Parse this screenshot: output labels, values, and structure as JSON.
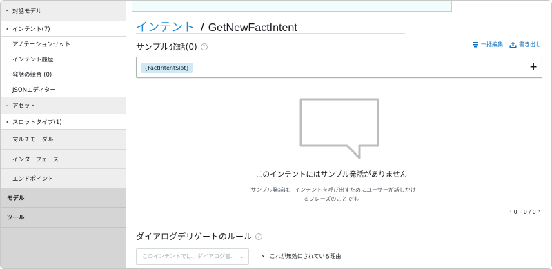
{
  "sidebar": {
    "section_dialog_model": "対話モデル",
    "items": [
      {
        "label": "インテント(7)",
        "chevron": "›"
      },
      {
        "label": "アノテーションセット"
      },
      {
        "label": "インテント履歴"
      },
      {
        "label": "発話の競合 (0)"
      },
      {
        "label": "JSONエディター"
      }
    ],
    "section_assets": "アセット",
    "slot_types": "スロットタイプ(1)",
    "multimodal": "マルチモーダル",
    "interfaces": "インターフェース",
    "endpoint": "エンドポイント",
    "model": "モデル",
    "tools": "ツール",
    "chevron_down": "⌄",
    "chevron_right": "›"
  },
  "header": {
    "breadcrumb_link": "インテント",
    "separator": "/",
    "intent_name": "GetNewFactIntent"
  },
  "utterances": {
    "title": "サンプル発話(0)",
    "help": "?",
    "bulk_edit": "一括編集",
    "export": "書き出し",
    "slot_chip": "{FactIntentSlot}",
    "add": "+",
    "empty_title": "このインテントにはサンプル発話がありません",
    "empty_desc": "サンプル発話は、インテントを呼び出すためにユーザーが話しかけるフレーズのことです。",
    "pager": "0 – 0 / 0",
    "pager_prev": "‹",
    "pager_next": "›"
  },
  "delegation": {
    "title": "ダイアログデリゲートのルール",
    "help": "?",
    "dropdown_placeholder": "このインテントでは、ダイアログ管...",
    "dropdown_chevron": "⌄",
    "reason_link": "これが無効にされている理由",
    "reason_chevron": "›"
  },
  "colors": {
    "accent": "#1a8cd8",
    "link": "#0a6ebd",
    "sidebar_bg": "#d5d5d5",
    "chip_bg": "#cfe9f7"
  }
}
